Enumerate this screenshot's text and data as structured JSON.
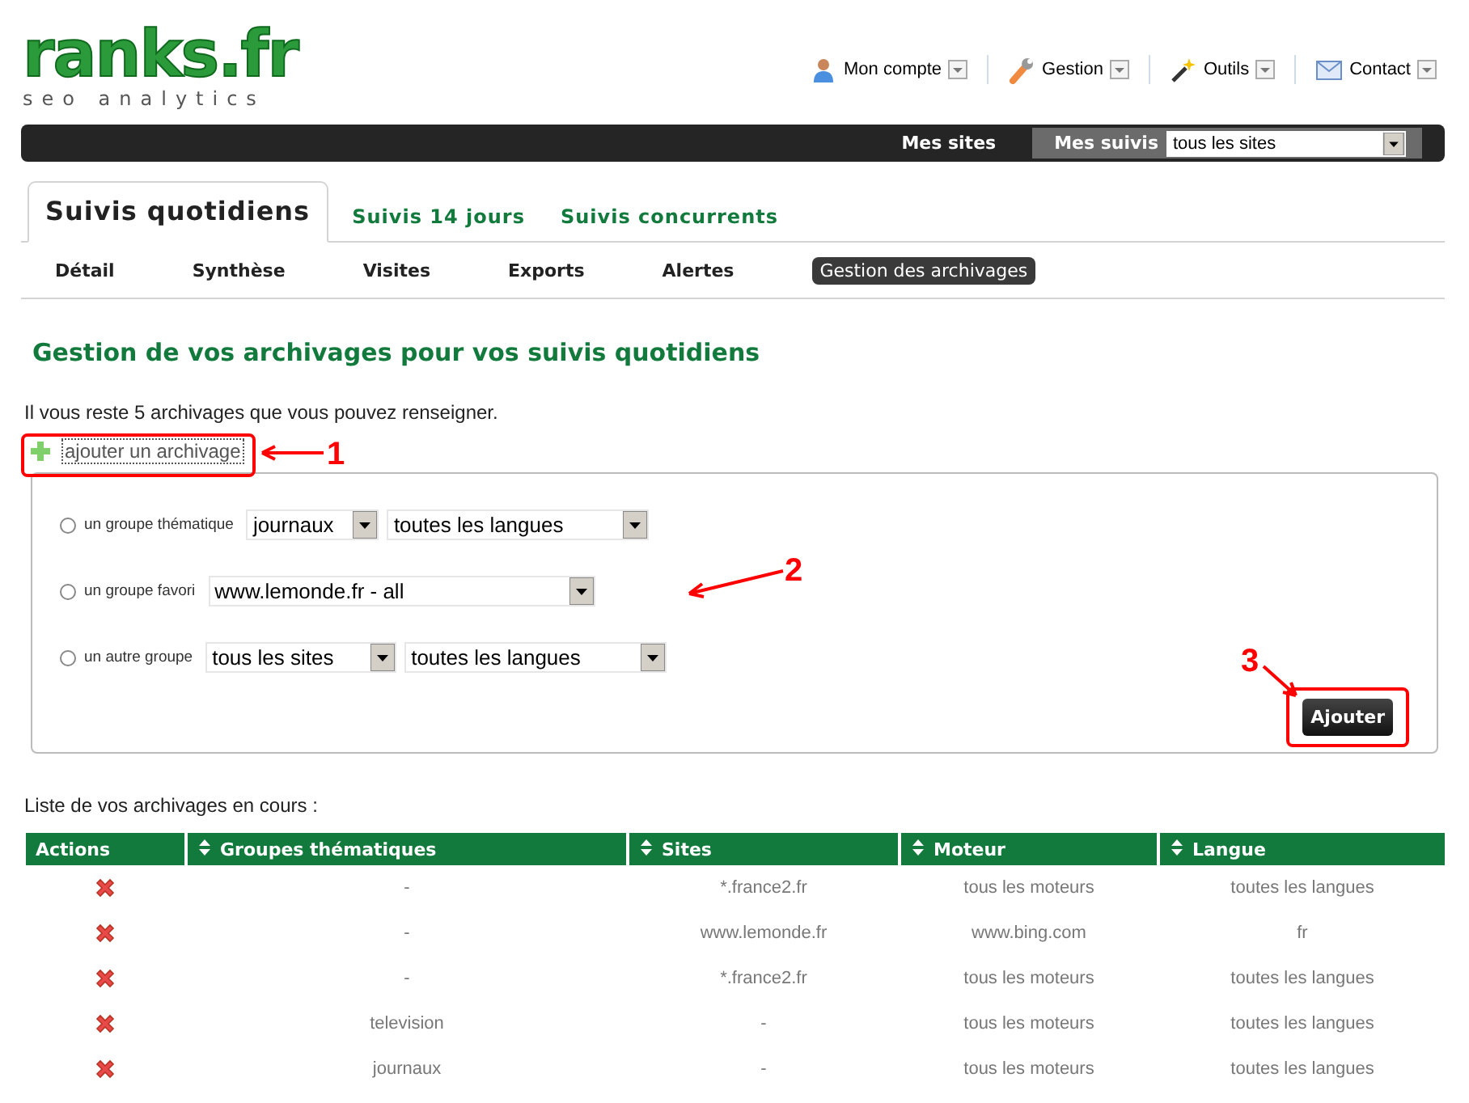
{
  "header": {
    "logo": "ranks.fr",
    "tagline": "seo analytics"
  },
  "top_menu": [
    {
      "label": "Mon compte",
      "kind": "user"
    },
    {
      "label": "Gestion",
      "kind": "wrench"
    },
    {
      "label": "Outils",
      "kind": "wand"
    },
    {
      "label": "Contact",
      "kind": "mail"
    }
  ],
  "top_bar": {
    "link": "Mes sites",
    "suivis_label": "Mes suivis",
    "suivis_select": "tous les sites"
  },
  "tabs": [
    {
      "label": "Suivis quotidiens",
      "selected": true
    },
    {
      "label": "Suivis 14 jours",
      "selected": false
    },
    {
      "label": "Suivis concurrents",
      "selected": false
    }
  ],
  "subtabs": [
    {
      "label": "Détail",
      "selected": false
    },
    {
      "label": "Synthèse",
      "selected": false
    },
    {
      "label": "Visites",
      "selected": false
    },
    {
      "label": "Exports",
      "selected": false
    },
    {
      "label": "Alertes",
      "selected": false
    },
    {
      "label": "Gestion des archivages",
      "selected": true
    }
  ],
  "heading": "Gestion de vos archivages pour vos suivis quotidiens",
  "info": "Il vous reste 5 archivages que vous pouvez renseigner.",
  "add_link": "ajouter un archivage",
  "form": {
    "options": [
      {
        "label": "un groupe thématique",
        "selected": false,
        "selects": [
          "journaux",
          "toutes les langues"
        ]
      },
      {
        "label": "un groupe favori",
        "selected": false,
        "selects": [
          "www.lemonde.fr - all"
        ]
      },
      {
        "label": "un autre groupe",
        "selected": false,
        "selects": [
          "tous les sites",
          "toutes les langues"
        ]
      }
    ],
    "submit": "Ajouter"
  },
  "list_title": "Liste de vos archivages en cours :",
  "table": {
    "columns": [
      {
        "label": "Actions",
        "sortable": false
      },
      {
        "label": "Groupes thématiques",
        "sortable": true
      },
      {
        "label": "Sites",
        "sortable": true
      },
      {
        "label": "Moteur",
        "sortable": true
      },
      {
        "label": "Langue",
        "sortable": true
      }
    ],
    "rows": [
      [
        "",
        "-",
        "*.france2.fr",
        "tous les moteurs",
        "toutes les langues"
      ],
      [
        "",
        "-",
        "www.lemonde.fr",
        "www.bing.com",
        "fr"
      ],
      [
        "",
        "-",
        "*.france2.fr",
        "tous les moteurs",
        "toutes les langues"
      ],
      [
        "",
        "television",
        "-",
        "tous les moteurs",
        "toutes les langues"
      ],
      [
        "",
        "journaux",
        "-",
        "tous les moteurs",
        "toutes les langues"
      ]
    ]
  },
  "annotations": [
    {
      "label": "1"
    },
    {
      "label": "2"
    },
    {
      "label": "3"
    }
  ]
}
